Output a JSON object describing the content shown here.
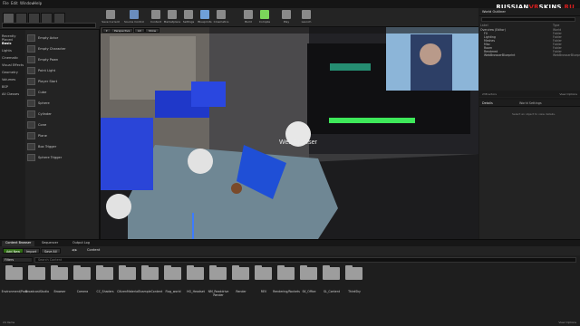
{
  "menu": {
    "items": [
      "File",
      "Edit",
      "Window",
      "Help"
    ]
  },
  "watermark": {
    "part1": "RUSSIAN",
    "part2": "VR",
    "part3": "SKINS",
    "part4": ".RU"
  },
  "modes": {
    "search_placeholder": "",
    "categories": [
      "Recently Placed",
      "Basic",
      "Lights",
      "Cinematic",
      "Visual Effects",
      "Geometry",
      "Volumes",
      "BSP",
      "All Classes"
    ],
    "active_category": "Basic",
    "assets": [
      "Empty Actor",
      "Empty Character",
      "Empty Pawn",
      "Point Light",
      "Player Start",
      "Cube",
      "Sphere",
      "Cylinder",
      "Cone",
      "Plane",
      "Box Trigger",
      "Sphere Trigger"
    ]
  },
  "toolbar": {
    "buttons": [
      {
        "label": "Save Current",
        "color": "#8a8a8a"
      },
      {
        "label": "Source Control",
        "color": "#6a8dbd"
      },
      {
        "label": "Content",
        "color": "#8a8a8a"
      },
      {
        "label": "Marketplace",
        "color": "#8a8a8a"
      },
      {
        "label": "Settings",
        "color": "#8a8a8a"
      },
      {
        "label": "Blueprints",
        "color": "#6fa0d8"
      },
      {
        "label": "Cinematics",
        "color": "#8a8a8a"
      },
      {
        "label": "Build",
        "color": "#8a8a8a"
      },
      {
        "label": "Compile",
        "color": "#7bd65a"
      },
      {
        "label": "Play",
        "color": "#8a8a8a"
      },
      {
        "label": "Launch",
        "color": "#8a8a8a"
      }
    ]
  },
  "viewport": {
    "tabs": [
      "Perspective",
      "Lit",
      "Show"
    ],
    "world_label": "Web Browser"
  },
  "outliner": {
    "title": "World Outliner",
    "columns": [
      "Label",
      "Type"
    ],
    "rows": [
      {
        "label": "Overview (Editor)",
        "type": "World"
      },
      {
        "label": "FX",
        "type": "Folder"
      },
      {
        "label": "Lighting",
        "type": "Folder"
      },
      {
        "label": "Meshes",
        "type": "Folder"
      },
      {
        "label": "Misc",
        "type": "Folder"
      },
      {
        "label": "Room",
        "type": "Folder"
      },
      {
        "label": "Rendered",
        "type": "Folder"
      },
      {
        "label": "WebBrowserBlueprint",
        "type": "WebBrowserBlueprint"
      }
    ],
    "footer": "238 actors",
    "view_options": "View Options"
  },
  "details": {
    "tabs": [
      "Details",
      "World Settings"
    ],
    "hint": "Select an object to view details."
  },
  "bottom_tabs": [
    "Content Browser",
    "Sequencer",
    "Output Log"
  ],
  "content_browser": {
    "add_new": "Add New",
    "import": "Import",
    "save_all": "Save All",
    "path": "Content",
    "filters": "Filters",
    "search_placeholder": "Search Content",
    "folders": [
      "Environment/Pack",
      "BroadcastStudio",
      "Browser",
      "Camera",
      "CC_Shaders",
      "CitizenMaterial",
      "ExampleContent",
      "Flag_world",
      "HG_Headset",
      "NM_Readdrive Render",
      "Render",
      "REV",
      "Rendering/Rockets",
      "SK_Office",
      "SL_Content",
      "ThirdSky"
    ],
    "items_count": "24 items",
    "view_options": "View Options"
  },
  "colors": {
    "accent_green": "#2f6b14",
    "watermark_red": "#d21e1e"
  }
}
